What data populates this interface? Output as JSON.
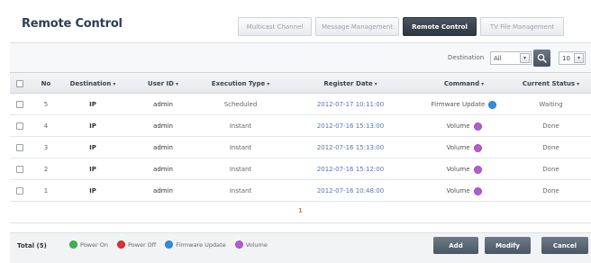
{
  "header": {
    "title": "Remote Control",
    "tabs": [
      {
        "label": "Multicast Channel"
      },
      {
        "label": "Message Management"
      },
      {
        "label": "Remote Control"
      },
      {
        "label": "TV File Management"
      }
    ]
  },
  "filter": {
    "label": "Destination",
    "destination_value": "All",
    "page_size_value": "10"
  },
  "table": {
    "columns": [
      "No",
      "Destination",
      "User ID",
      "Execution Type",
      "Register Date",
      "Command",
      "Current Status"
    ],
    "rows": [
      {
        "no": "5",
        "destination": "IP",
        "user_id": "admin",
        "execution_type": "Scheduled",
        "register_date": "2012-07-17 10:11:00",
        "command": "Firmware Update",
        "command_color": "#2f8fe0",
        "status": "Waiting"
      },
      {
        "no": "4",
        "destination": "IP",
        "user_id": "admin",
        "execution_type": "Instant",
        "register_date": "2012-07-16 15:13:00",
        "command": "Volume",
        "command_color": "#b35bd6",
        "status": "Done"
      },
      {
        "no": "3",
        "destination": "IP",
        "user_id": "admin",
        "execution_type": "Instant",
        "register_date": "2012-07-16 15:13:00",
        "command": "Volume",
        "command_color": "#b35bd6",
        "status": "Done"
      },
      {
        "no": "2",
        "destination": "IP",
        "user_id": "admin",
        "execution_type": "Instant",
        "register_date": "2012-07-16 15:12:00",
        "command": "Volume",
        "command_color": "#b35bd6",
        "status": "Done"
      },
      {
        "no": "1",
        "destination": "IP",
        "user_id": "admin",
        "execution_type": "Instant",
        "register_date": "2012-07-16 10:48:00",
        "command": "Volume",
        "command_color": "#b35bd6",
        "status": "Done"
      }
    ],
    "pager": "1"
  },
  "footer": {
    "total": "Total (5)",
    "legend": [
      {
        "label": "Power On",
        "color": "#3fb54a"
      },
      {
        "label": "Power Off",
        "color": "#e0302f"
      },
      {
        "label": "Firmware Update",
        "color": "#2f8fe0"
      },
      {
        "label": "Volume",
        "color": "#b35bd6"
      }
    ],
    "add_label": "Add",
    "modify_label": "Modify",
    "cancel_label": "Cancel"
  }
}
